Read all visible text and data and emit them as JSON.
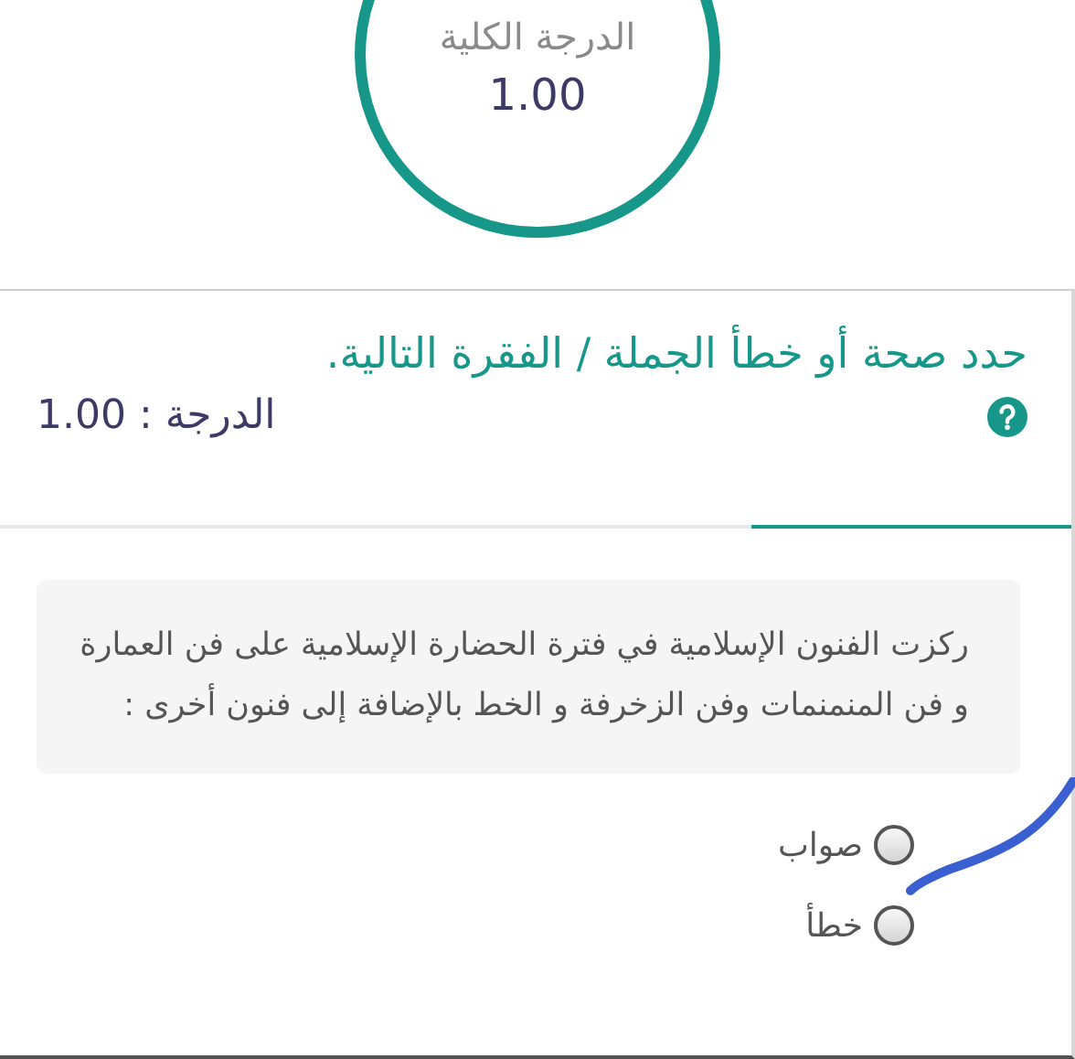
{
  "total_grade": {
    "label": "الدرجة الكلية",
    "value": "1.00"
  },
  "question": {
    "title": "حدد صحة أو خطأ الجملة / الفقرة التالية.",
    "grade": "الدرجة : 1.00",
    "statement": "ركزت الفنون الإسلامية في فترة الحضارة الإسلامية على فن العمارة و فن المنمنمات وفن الزخرفة و الخط بالإضافة إلى فنون أخرى :",
    "options": [
      {
        "label": "صواب",
        "selected": false
      },
      {
        "label": "خطأ",
        "selected": false
      }
    ]
  }
}
